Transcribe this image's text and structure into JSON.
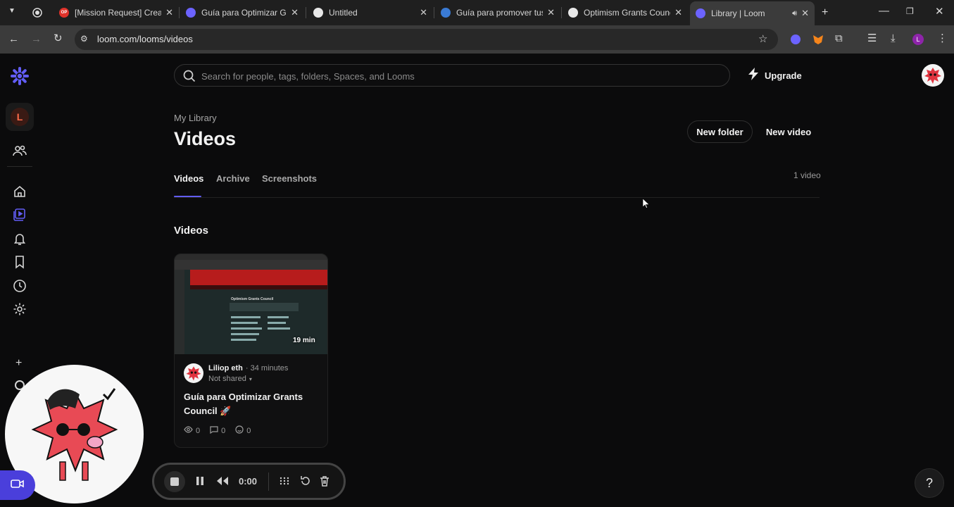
{
  "browser": {
    "tabs": [
      {
        "title": "[Mission Request] Create",
        "favicon_text": "OP",
        "favicon_color": "#e0322a"
      },
      {
        "title": "Guía para Optimizar Gran",
        "favicon_color": "#6c63ff"
      },
      {
        "title": "Untitled",
        "favicon_color": "#e8e8e8"
      },
      {
        "title": "Guía para promover tus p",
        "favicon_color": "#3a7bd5"
      },
      {
        "title": "Optimism Grants Council",
        "favicon_color": "#e8e8e8"
      },
      {
        "title": "Library | Loom",
        "favicon_color": "#6c63ff"
      }
    ],
    "url": "loom.com/looms/videos",
    "profile_initial": "L"
  },
  "sidebar": {
    "workspace_initial": "L",
    "accent_color": "#625df5"
  },
  "search": {
    "placeholder": "Search for people, tags, folders, Spaces, and Looms"
  },
  "header": {
    "upgrade_label": "Upgrade",
    "breadcrumb": "My Library",
    "title": "Videos",
    "new_folder_label": "New folder",
    "new_video_label": "New video"
  },
  "tabs": {
    "items": [
      "Videos",
      "Archive",
      "Screenshots"
    ],
    "active": "Videos",
    "count_label": "1 video"
  },
  "section": {
    "title": "Videos"
  },
  "video_card": {
    "duration": "19 min",
    "author": "Liliop eth",
    "time_ago": "· 34 minutes",
    "sharing": "Not shared",
    "title": "Guía para Optimizar Grants Council 🚀",
    "views": "0",
    "comments": "0",
    "reactions": "0",
    "thumb_heading": "Optimism Grants Council"
  },
  "recorder": {
    "timer": "0:00"
  },
  "help": {
    "label": "?"
  }
}
